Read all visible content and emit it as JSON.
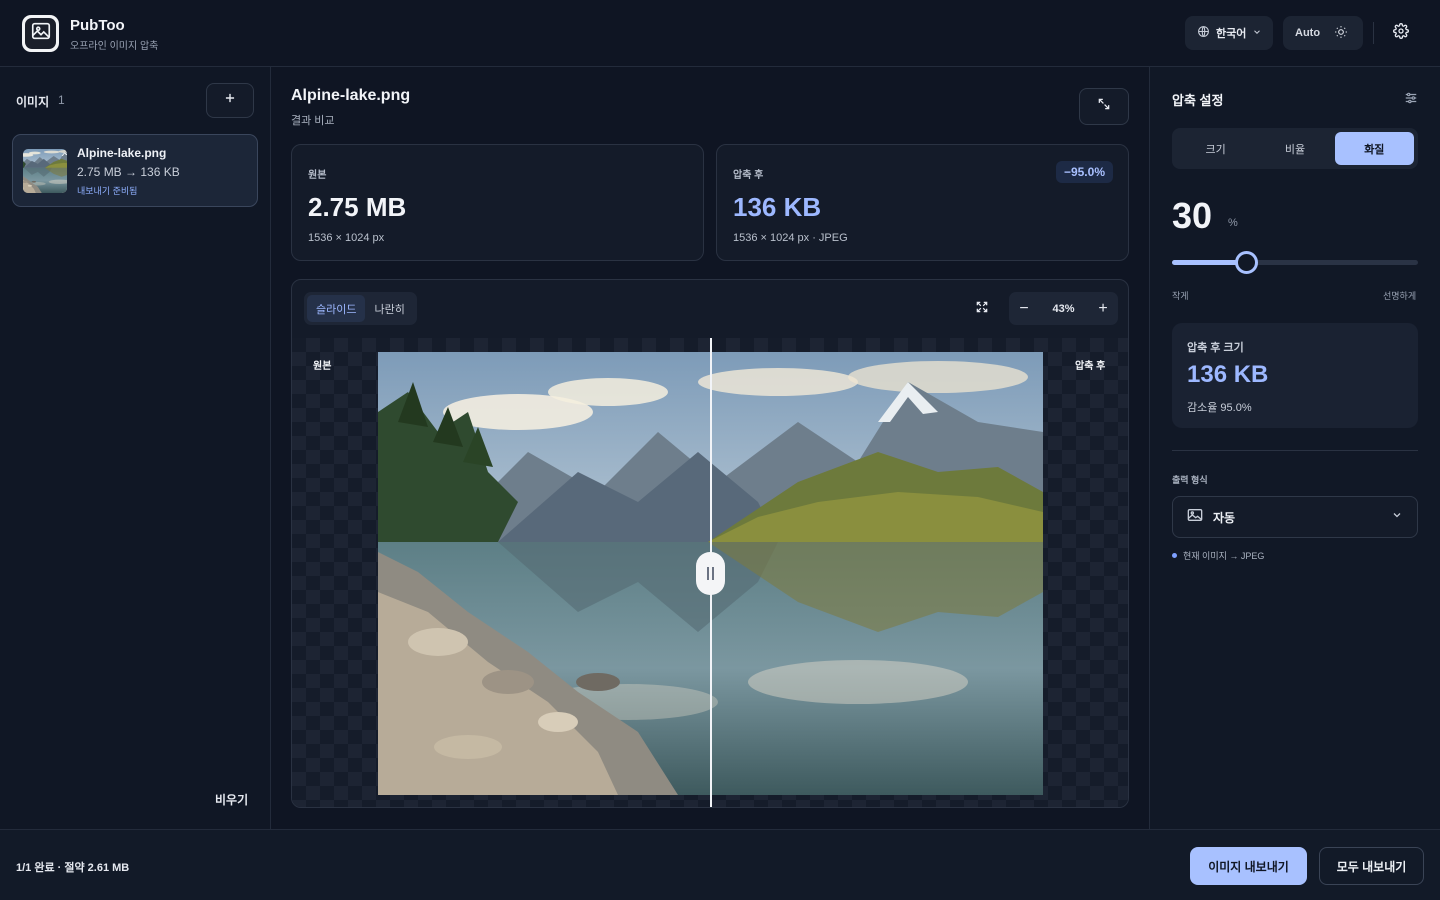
{
  "colors": {
    "accent": "#a8c1ff",
    "accent_text": "#9db8ff",
    "background": "#0f1523",
    "panel": "#141b29"
  },
  "header": {
    "app_name": "PubToo",
    "app_subtitle": "오프라인 이미지 압축",
    "logo_icon": "image-icon",
    "language": {
      "label": "한국어",
      "icon": "globe-icon"
    },
    "theme": {
      "label": "Auto",
      "icon": "sun-icon"
    },
    "settings_icon": "gear-icon"
  },
  "sidebar": {
    "title": "이미지",
    "count": "1",
    "add_icon": "plus-icon",
    "files": [
      {
        "name": "Alpine-lake.png",
        "size": "2.75 MB → 136 KB",
        "status": "내보내기 준비됨"
      }
    ],
    "clear_label": "비우기"
  },
  "main": {
    "title": "Alpine-lake.png",
    "subtitle": "결과 비교",
    "expand_icon": "expand-icon",
    "original": {
      "label": "원본",
      "size": "2.75 MB",
      "meta": "1536 × 1024 px"
    },
    "compressed": {
      "label": "압축 후",
      "size": "136 KB",
      "meta": "1536 × 1024 px · JPEG",
      "badge": "−95.0%"
    },
    "viewer": {
      "modes": [
        "슬라이드",
        "나란히"
      ],
      "active_mode": "슬라이드",
      "fit_icon": "fit-screen-icon",
      "zoom": "43%",
      "zoom_out": "−",
      "zoom_in": "+",
      "left_label": "원본",
      "right_label": "압축 후",
      "slider_position": 0.5
    }
  },
  "settings": {
    "title": "압축 설정",
    "options_icon": "sliders-icon",
    "tabs": [
      "크기",
      "비율",
      "화질"
    ],
    "active_tab": "화질",
    "quality_value": "30",
    "quality_unit": "%",
    "quality_fraction": 0.3,
    "slider_min_label": "작게",
    "slider_max_label": "선명하게",
    "result_label": "압축 후 크기",
    "result_size": "136 KB",
    "result_reduction": "감소율 95.0%",
    "format_label": "출력 형식",
    "format_value": "자동",
    "format_icon": "image-icon",
    "format_note": "현재 이미지 → JPEG"
  },
  "footer": {
    "status": "1/1 완료 · 절약 2.61 MB",
    "export_label": "이미지 내보내기",
    "export_all_label": "모두 내보내기"
  }
}
